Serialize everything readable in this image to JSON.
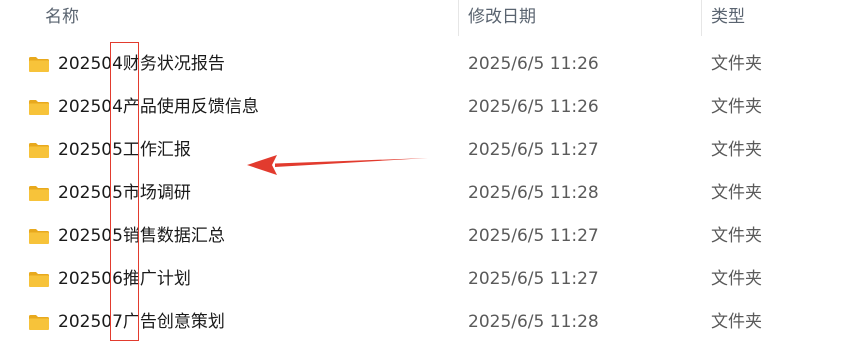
{
  "columns": {
    "name": "名称",
    "date_modified": "修改日期",
    "type": "类型"
  },
  "files": [
    {
      "name": "202504财务状况报告",
      "date": "2025/6/5 11:26",
      "type": "文件夹"
    },
    {
      "name": "202504产品使用反馈信息",
      "date": "2025/6/5 11:26",
      "type": "文件夹"
    },
    {
      "name": "202505工作汇报",
      "date": "2025/6/5 11:27",
      "type": "文件夹"
    },
    {
      "name": "202505市场调研",
      "date": "2025/6/5 11:28",
      "type": "文件夹"
    },
    {
      "name": "202505销售数据汇总",
      "date": "2025/6/5 11:27",
      "type": "文件夹"
    },
    {
      "name": "202506推广计划",
      "date": "2025/6/5 11:27",
      "type": "文件夹"
    },
    {
      "name": "202507广告创意策划",
      "date": "2025/6/5 11:28",
      "type": "文件夹"
    }
  ],
  "icons": {
    "row_icon": "folder-icon",
    "sort_indicator": "chevron-up-icon"
  },
  "colors": {
    "folder": "#f7c33a",
    "annotation": "#e23b2e",
    "header_text": "#5a6470"
  }
}
